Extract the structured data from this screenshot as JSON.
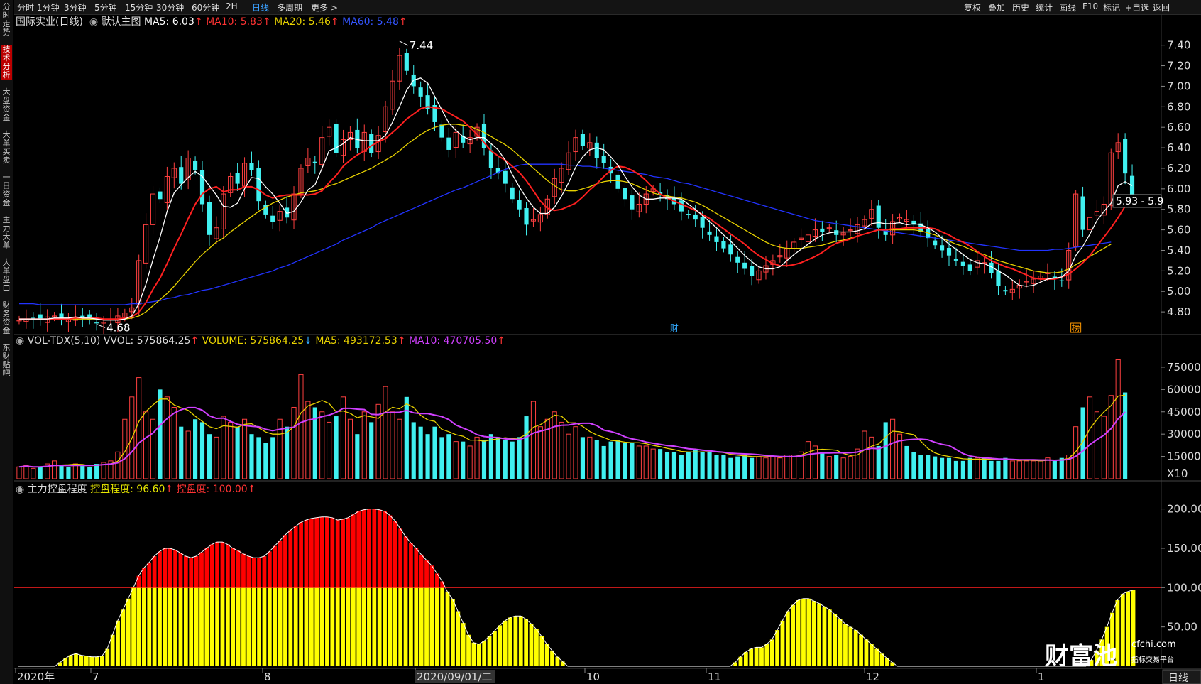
{
  "topbar": {
    "left_items": [
      "分时",
      "1分钟",
      "3分钟",
      "5分钟",
      "15分钟",
      "30分钟",
      "60分钟",
      "2H",
      "日线",
      "多周期",
      "更多 >"
    ],
    "active": "日线",
    "right_items": [
      "复权",
      "叠加",
      "历史",
      "统计",
      "画线",
      "F10",
      "标记",
      "+自选",
      "返回"
    ]
  },
  "sidebar": {
    "items": [
      "分时走势",
      "技术分析",
      "大盘资金",
      "大单买卖",
      "一日资金",
      "主力大单",
      "大单盘口",
      "财务资金",
      "东财贴吧"
    ],
    "active": "技术分析"
  },
  "main_panel": {
    "title": "国际实业(日线)",
    "indicator_name": "默认主图",
    "ma5": "MA5: 6.03",
    "ma10": "MA10: 5.83",
    "ma20": "MA20: 5.46",
    "ma60": "MA60: 5.48",
    "high_label": "7.44",
    "low_label": "4.68",
    "crosshair_label": "5.93 - 5.9",
    "event_marks": [
      "财",
      "榜"
    ],
    "colors": {
      "ma5": "#ffffff",
      "ma10": "#ff2020",
      "ma20": "#e8d200",
      "ma60": "#2233ff",
      "up": "#ff4040",
      "down": "#40f0f0"
    }
  },
  "vol_panel": {
    "name": "VOL-TDX(5,10)",
    "vvol": "VVOL: 575864.25",
    "volume": "VOLUME: 575864.25",
    "ma5": "MA5: 493172.53",
    "ma10": "MA10: 470705.50",
    "unit": "X10"
  },
  "control_panel": {
    "name": "主力控盘程度",
    "degree": "控盘程度: 96.60",
    "line": "控盘度: 100.00"
  },
  "x_axis": {
    "labels": [
      "2020年",
      "7",
      "8",
      "2020/09/01/二",
      "10",
      "11",
      "12",
      "1"
    ],
    "period_button": "日线"
  },
  "watermark": {
    "brand": "财富池",
    "site": "cfchi.com",
    "slogan": "指标交易平台"
  },
  "chart_data": [
    {
      "type": "candlestick",
      "title": "国际实业(日线)",
      "ylim": [
        4.6,
        7.55
      ],
      "yticks": [
        4.8,
        5.0,
        5.2,
        5.4,
        5.6,
        5.8,
        6.0,
        6.2,
        6.4,
        6.6,
        6.8,
        7.0,
        7.2,
        7.4
      ],
      "close": [
        4.72,
        4.73,
        4.74,
        4.72,
        4.75,
        4.76,
        4.74,
        4.73,
        4.75,
        4.74,
        4.72,
        4.69,
        4.7,
        4.73,
        4.76,
        4.79,
        4.84,
        5.3,
        5.65,
        5.95,
        5.9,
        6.12,
        6.2,
        6.05,
        6.3,
        6.18,
        5.85,
        5.55,
        5.62,
        5.95,
        6.12,
        6.05,
        6.25,
        6.18,
        5.88,
        5.75,
        5.68,
        5.78,
        5.72,
        5.95,
        6.2,
        6.3,
        6.25,
        6.5,
        6.6,
        6.35,
        6.48,
        6.55,
        6.4,
        6.55,
        6.35,
        6.52,
        6.8,
        7.05,
        7.3,
        7.15,
        7.0,
        6.9,
        6.78,
        6.65,
        6.5,
        6.38,
        6.55,
        6.45,
        6.5,
        6.6,
        6.4,
        6.2,
        6.15,
        6.05,
        5.9,
        5.8,
        5.65,
        5.7,
        5.75,
        5.9,
        6.1,
        6.2,
        6.35,
        6.5,
        6.42,
        6.45,
        6.3,
        6.25,
        6.15,
        6.0,
        5.9,
        5.8,
        5.85,
        5.95,
        6.0,
        5.95,
        5.9,
        5.85,
        5.78,
        5.75,
        5.7,
        5.62,
        5.55,
        5.48,
        5.42,
        5.36,
        5.28,
        5.22,
        5.15,
        5.2,
        5.25,
        5.3,
        5.35,
        5.42,
        5.48,
        5.52,
        5.55,
        5.6,
        5.58,
        5.62,
        5.55,
        5.57,
        5.6,
        5.65,
        5.7,
        5.8,
        5.62,
        5.55,
        5.68,
        5.72,
        5.7,
        5.65,
        5.58,
        5.52,
        5.45,
        5.4,
        5.35,
        5.3,
        5.25,
        5.2,
        5.3,
        5.28,
        5.18,
        5.05,
        5.0,
        5.02,
        5.06,
        5.1,
        5.12,
        5.15,
        5.18,
        5.12,
        5.1,
        5.4,
        5.95,
        5.6,
        5.72,
        5.78,
        5.85,
        6.35,
        6.45,
        6.15,
        5.93
      ],
      "volume": [
        8,
        9,
        7,
        8,
        10,
        12,
        9,
        8,
        10,
        9,
        8,
        10,
        11,
        12,
        18,
        40,
        55,
        68,
        45,
        40,
        60,
        55,
        48,
        35,
        32,
        40,
        38,
        30,
        28,
        42,
        38,
        35,
        40,
        30,
        28,
        24,
        28,
        40,
        35,
        48,
        70,
        52,
        48,
        45,
        38,
        42,
        55,
        40,
        30,
        45,
        38,
        50,
        62,
        45,
        40,
        55,
        38,
        35,
        30,
        35,
        28,
        30,
        25,
        25,
        22,
        28,
        26,
        30,
        28,
        26,
        25,
        28,
        42,
        52,
        35,
        40,
        45,
        38,
        30,
        35,
        28,
        28,
        26,
        22,
        25,
        26,
        24,
        24,
        22,
        22,
        20,
        20,
        18,
        18,
        16,
        18,
        20,
        18,
        18,
        16,
        16,
        14,
        15,
        16,
        14,
        15,
        14,
        15,
        14,
        16,
        16,
        18,
        25,
        22,
        18,
        15,
        16,
        14,
        15,
        20,
        32,
        28,
        22,
        38,
        40,
        30,
        22,
        18,
        16,
        16,
        15,
        14,
        14,
        12,
        12,
        14,
        14,
        14,
        12,
        12,
        14,
        12,
        12,
        12,
        12,
        12,
        14,
        12,
        14,
        16,
        35,
        48,
        55,
        45,
        42,
        56,
        80,
        58
      ],
      "ma5": [
        4.73,
        4.73,
        4.73,
        4.73,
        4.73,
        4.74,
        4.74,
        4.74,
        4.75,
        4.74,
        4.74,
        4.73,
        4.72,
        4.72,
        4.72,
        4.73,
        4.76,
        4.88,
        5.07,
        5.31,
        5.53,
        5.78,
        5.96,
        6.04,
        6.11,
        6.17,
        6.12,
        6.03,
        5.94,
        5.83,
        5.82,
        5.86,
        6.0,
        6.11,
        6.1,
        6.02,
        5.95,
        5.86,
        5.76,
        5.78,
        5.87,
        5.99,
        6.04,
        6.2,
        6.37,
        6.4,
        6.44,
        6.5,
        6.48,
        6.47,
        6.47,
        6.47,
        6.52,
        6.65,
        6.8,
        6.96,
        7.06,
        7.08,
        7.03,
        6.9,
        6.77,
        6.64,
        6.57,
        6.51,
        6.48,
        6.5,
        6.5,
        6.44,
        6.38,
        6.28,
        6.14,
        6.02,
        5.91,
        5.82,
        5.76,
        5.76,
        5.82,
        5.93,
        6.06,
        6.21,
        6.31,
        6.38,
        6.4,
        6.38,
        6.31,
        6.23,
        6.12,
        6.02,
        5.94,
        5.9,
        5.9,
        5.91,
        5.91,
        5.91,
        5.9,
        5.85,
        5.8,
        5.74,
        5.68,
        5.62,
        5.55,
        5.49,
        5.42,
        5.35,
        5.29,
        5.24,
        5.22,
        5.22,
        5.24,
        5.3,
        5.36,
        5.41,
        5.46,
        5.51,
        5.55,
        5.57,
        5.58,
        5.58,
        5.58,
        5.59,
        5.61,
        5.66,
        5.67,
        5.66,
        5.66,
        5.67,
        5.65,
        5.66,
        5.65,
        5.62,
        5.58,
        5.52,
        5.46,
        5.41,
        5.36,
        5.31,
        5.28,
        5.27,
        5.24,
        5.2,
        5.16,
        5.11,
        5.06,
        5.05,
        5.06,
        5.09,
        5.12,
        5.13,
        5.14,
        5.2,
        5.35,
        5.44,
        5.56,
        5.69,
        5.78,
        5.86,
        6.03,
        6.07,
        6.03
      ],
      "ma10": [
        4.73,
        4.73,
        4.73,
        4.73,
        4.73,
        4.73,
        4.73,
        4.73,
        4.74,
        4.74,
        4.74,
        4.74,
        4.73,
        4.73,
        4.73,
        4.74,
        4.75,
        4.8,
        4.89,
        5.02,
        5.13,
        5.27,
        5.42,
        5.56,
        5.71,
        5.85,
        5.95,
        6.0,
        6.02,
        5.97,
        5.99,
        5.99,
        6.02,
        6.02,
        5.99,
        5.94,
        5.91,
        5.93,
        5.94,
        5.94,
        5.94,
        5.94,
        5.95,
        5.98,
        6.06,
        6.13,
        6.22,
        6.28,
        6.33,
        6.37,
        6.42,
        6.46,
        6.49,
        6.55,
        6.61,
        6.68,
        6.73,
        6.78,
        6.8,
        6.79,
        6.78,
        6.74,
        6.7,
        6.66,
        6.6,
        6.53,
        6.45,
        6.37,
        6.32,
        6.28,
        6.22,
        6.16,
        6.08,
        5.98,
        5.88,
        5.81,
        5.79,
        5.8,
        5.83,
        5.86,
        5.92,
        5.99,
        6.05,
        6.12,
        6.18,
        6.22,
        6.21,
        6.18,
        6.14,
        6.08,
        6.01,
        5.95,
        5.91,
        5.88,
        5.85,
        5.82,
        5.79,
        5.75,
        5.71,
        5.66,
        5.61,
        5.56,
        5.51,
        5.46,
        5.4,
        5.35,
        5.31,
        5.27,
        5.25,
        5.25,
        5.26,
        5.28,
        5.31,
        5.34,
        5.38,
        5.43,
        5.47,
        5.49,
        5.51,
        5.54,
        5.56,
        5.58,
        5.6,
        5.6,
        5.61,
        5.61,
        5.62,
        5.62,
        5.62,
        5.62,
        5.61,
        5.58,
        5.55,
        5.51,
        5.48,
        5.44,
        5.39,
        5.34,
        5.3,
        5.27,
        5.24,
        5.22,
        5.19,
        5.16,
        5.13,
        5.12,
        5.12,
        5.12,
        5.14,
        5.17,
        5.22,
        5.28,
        5.35,
        5.44,
        5.53,
        5.62,
        5.72,
        5.83
      ],
      "ma20": [
        4.73,
        4.73,
        4.73,
        4.73,
        4.73,
        4.73,
        4.73,
        4.73,
        4.73,
        4.73,
        4.73,
        4.73,
        4.73,
        4.73,
        4.73,
        4.73,
        4.74,
        4.76,
        4.8,
        4.86,
        4.92,
        4.98,
        5.05,
        5.13,
        5.21,
        5.29,
        5.36,
        5.42,
        5.48,
        5.52,
        5.58,
        5.63,
        5.68,
        5.73,
        5.78,
        5.82,
        5.86,
        5.89,
        5.92,
        5.94,
        5.96,
        5.97,
        5.98,
        6.0,
        6.03,
        6.05,
        6.08,
        6.11,
        6.14,
        6.17,
        6.2,
        6.24,
        6.28,
        6.32,
        6.37,
        6.43,
        6.48,
        6.53,
        6.57,
        6.6,
        6.62,
        6.63,
        6.63,
        6.62,
        6.61,
        6.58,
        6.55,
        6.51,
        6.47,
        6.43,
        6.38,
        6.32,
        6.26,
        6.2,
        6.14,
        6.08,
        6.03,
        5.99,
        5.98,
        5.98,
        6.0,
        6.02,
        6.05,
        6.07,
        6.08,
        6.08,
        6.07,
        6.05,
        6.02,
        5.99,
        5.96,
        5.94,
        5.93,
        5.92,
        5.91,
        5.89,
        5.87,
        5.84,
        5.8,
        5.76,
        5.72,
        5.68,
        5.64,
        5.6,
        5.56,
        5.52,
        5.48,
        5.45,
        5.43,
        5.42,
        5.42,
        5.42,
        5.43,
        5.44,
        5.45,
        5.47,
        5.49,
        5.5,
        5.52,
        5.54,
        5.56,
        5.58,
        5.6,
        5.6,
        5.6,
        5.6,
        5.6,
        5.6,
        5.59,
        5.57,
        5.55,
        5.52,
        5.49,
        5.46,
        5.44,
        5.41,
        5.38,
        5.36,
        5.33,
        5.3,
        5.28,
        5.26,
        5.24,
        5.22,
        5.2,
        5.19,
        5.18,
        5.18,
        5.19,
        5.22,
        5.26,
        5.3,
        5.34,
        5.38,
        5.42,
        5.46
      ],
      "ma60": [
        4.88,
        4.88,
        4.88,
        4.87,
        4.87,
        4.87,
        4.87,
        4.87,
        4.87,
        4.87,
        4.87,
        4.87,
        4.87,
        4.87,
        4.87,
        4.87,
        4.88,
        4.88,
        4.89,
        4.9,
        4.91,
        4.93,
        4.94,
        4.96,
        4.97,
        4.99,
        5.01,
        5.02,
        5.04,
        5.06,
        5.08,
        5.1,
        5.12,
        5.14,
        5.16,
        5.18,
        5.2,
        5.23,
        5.25,
        5.28,
        5.31,
        5.34,
        5.37,
        5.4,
        5.43,
        5.46,
        5.5,
        5.53,
        5.56,
        5.59,
        5.62,
        5.66,
        5.69,
        5.72,
        5.75,
        5.78,
        5.81,
        5.84,
        5.87,
        5.9,
        5.93,
        5.96,
        5.99,
        6.01,
        6.04,
        6.07,
        6.1,
        6.13,
        6.16,
        6.19,
        6.21,
        6.23,
        6.24,
        6.24,
        6.24,
        6.24,
        6.24,
        6.24,
        6.23,
        6.23,
        6.22,
        6.22,
        6.21,
        6.2,
        6.19,
        6.18,
        6.17,
        6.16,
        6.15,
        6.14,
        6.12,
        6.11,
        6.1,
        6.08,
        6.06,
        6.05,
        6.03,
        6.01,
        5.99,
        5.97,
        5.95,
        5.93,
        5.91,
        5.89,
        5.87,
        5.85,
        5.83,
        5.81,
        5.79,
        5.77,
        5.75,
        5.73,
        5.71,
        5.69,
        5.68,
        5.67,
        5.66,
        5.65,
        5.64,
        5.63,
        5.62,
        5.61,
        5.6,
        5.59,
        5.58,
        5.57,
        5.56,
        5.55,
        5.54,
        5.53,
        5.52,
        5.51,
        5.5,
        5.49,
        5.48,
        5.47,
        5.46,
        5.45,
        5.44,
        5.43,
        5.42,
        5.41,
        5.4,
        5.4,
        5.4,
        5.4,
        5.4,
        5.41,
        5.41,
        5.42,
        5.43,
        5.44,
        5.45,
        5.46,
        5.47,
        5.48
      ],
      "control": [
        0,
        0,
        0,
        0,
        0,
        0,
        0,
        0,
        5,
        10,
        14,
        16,
        14,
        13,
        12,
        12,
        13,
        22,
        40,
        58,
        72,
        86,
        100,
        115,
        125,
        132,
        140,
        146,
        150,
        150,
        148,
        144,
        140,
        138,
        140,
        145,
        150,
        155,
        158,
        158,
        155,
        150,
        147,
        143,
        140,
        138,
        138,
        140,
        146,
        153,
        160,
        167,
        173,
        178,
        183,
        186,
        188,
        189,
        190,
        190,
        189,
        186,
        187,
        189,
        193,
        197,
        199,
        200,
        200,
        199,
        197,
        192,
        185,
        175,
        165,
        157,
        150,
        142,
        135,
        128,
        118,
        108,
        95,
        85,
        70,
        55,
        40,
        30,
        28,
        32,
        38,
        45,
        52,
        58,
        62,
        64,
        64,
        60,
        54,
        47,
        38,
        28,
        20,
        12,
        6,
        0,
        0,
        0,
        0,
        0,
        0,
        0,
        0,
        0,
        0,
        0,
        0,
        0,
        0,
        0,
        0,
        0,
        0,
        0,
        0,
        0,
        0,
        0,
        0,
        0,
        0,
        0,
        0,
        0,
        0,
        0,
        0,
        5,
        12,
        18,
        22,
        24,
        24,
        28,
        34,
        46,
        58,
        70,
        78,
        84,
        86,
        86,
        83,
        80,
        76,
        72,
        66,
        60,
        54,
        50,
        46,
        40,
        34,
        28,
        22,
        16,
        10,
        5,
        0,
        0,
        0,
        0,
        0,
        0,
        0,
        0,
        0,
        0,
        0,
        0,
        0,
        0,
        0,
        0,
        0,
        0,
        0,
        0,
        0,
        0,
        0,
        0,
        0,
        0,
        0,
        0,
        0,
        0,
        0,
        0,
        0,
        0,
        0,
        0,
        0,
        8,
        20,
        34,
        50,
        68,
        84,
        92,
        95,
        97
      ],
      "vol_yticks": [
        15000,
        30000,
        45000,
        60000,
        75000
      ],
      "ctrl_yticks": [
        50.0,
        100.0,
        150.0,
        200.0
      ]
    }
  ]
}
